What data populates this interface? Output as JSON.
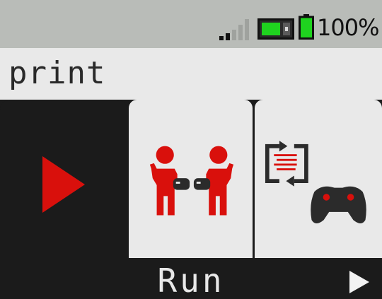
{
  "status_bar": {
    "signal_icon": "signal-strength-icon",
    "sim_icon": "sim-card-icon",
    "battery_icon": "battery-icon",
    "battery_level": "100%"
  },
  "header": {
    "title": "print"
  },
  "menu": {
    "items": [
      {
        "name": "Run",
        "icon": "play-icon",
        "selected": true
      },
      {
        "icon": "two-players-controller-icon",
        "selected": false
      },
      {
        "icon": "transfer-remote-controller-icon",
        "selected": false
      }
    ],
    "selected_label": "Run",
    "next_icon": "right-arrow-icon"
  },
  "colors": {
    "accent": "#d9100c",
    "status_green": "#1fd31f",
    "dark": "#1b1b1b",
    "light": "#e9e9e9",
    "statusbar": "#b9bcb8"
  }
}
